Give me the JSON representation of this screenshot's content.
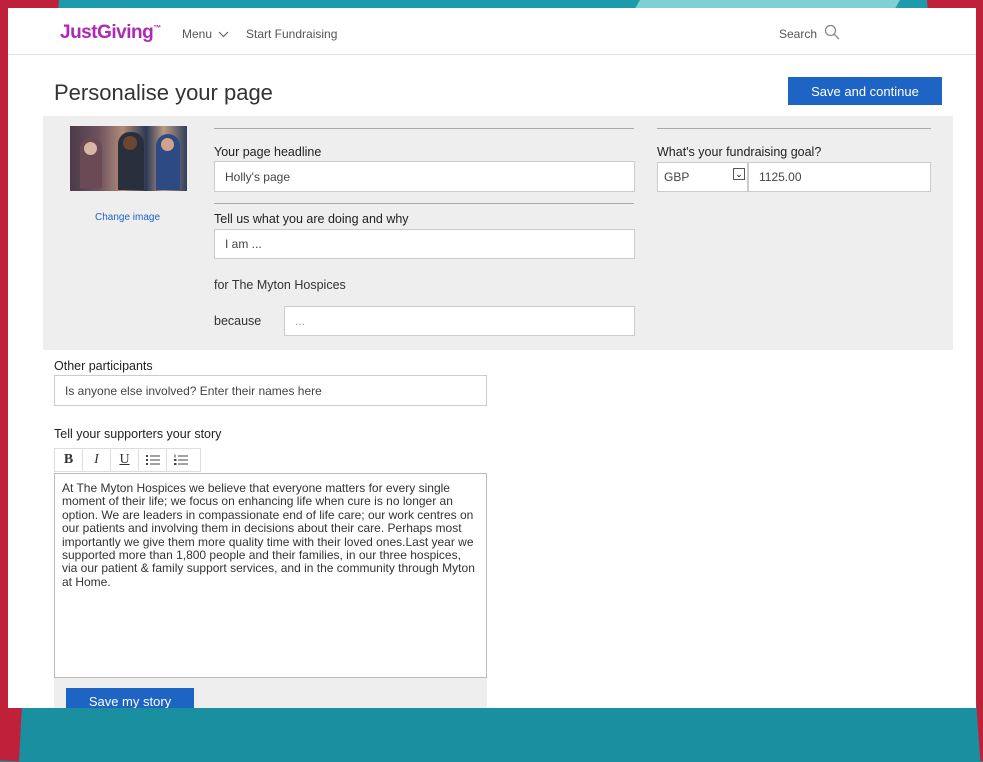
{
  "header": {
    "logo": "JustGiving",
    "logo_tm": "™",
    "menu_label": "Menu",
    "start_fundraising": "Start Fundraising",
    "search_label": "Search"
  },
  "page": {
    "title": "Personalise your page",
    "save_continue": "Save and continue"
  },
  "image": {
    "change_image": "Change image"
  },
  "form": {
    "headline_label": "Your page headline",
    "headline_value": "Holly's page",
    "doing_label": "Tell us what you are doing and why",
    "doing_value": "I am ...",
    "charity_text": "for The Myton Hospices",
    "because_label": "because",
    "because_value": "...",
    "goal_label": "What's your fundraising goal?",
    "currency": "GBP",
    "goal_value": "1125.00",
    "participants_label": "Other participants",
    "participants_placeholder": "Is anyone else involved? Enter their names here",
    "story_label": "Tell your supporters your story",
    "story_text": "At The Myton Hospices we believe that everyone matters for every single moment of their life; we focus on enhancing life when cure is no longer an option. We are leaders in compassionate end of life care; our work centres on our patients and involving them in decisions about their care. Perhaps most importantly we give them more quality time with their loved ones.Last year we supported more than 1,800 people and their families, in our three hospices, via our patient & family support services, and in the community through Myton at Home.",
    "save_story": "Save my story"
  },
  "toolbar": {
    "bold": "B",
    "italic": "I",
    "underline": "U",
    "bullet_list_icon": "bullet-list-icon",
    "numbered_list_icon": "numbered-list-icon"
  },
  "colors": {
    "brand": "#ad29b6",
    "primary_button": "#1d64c4"
  }
}
